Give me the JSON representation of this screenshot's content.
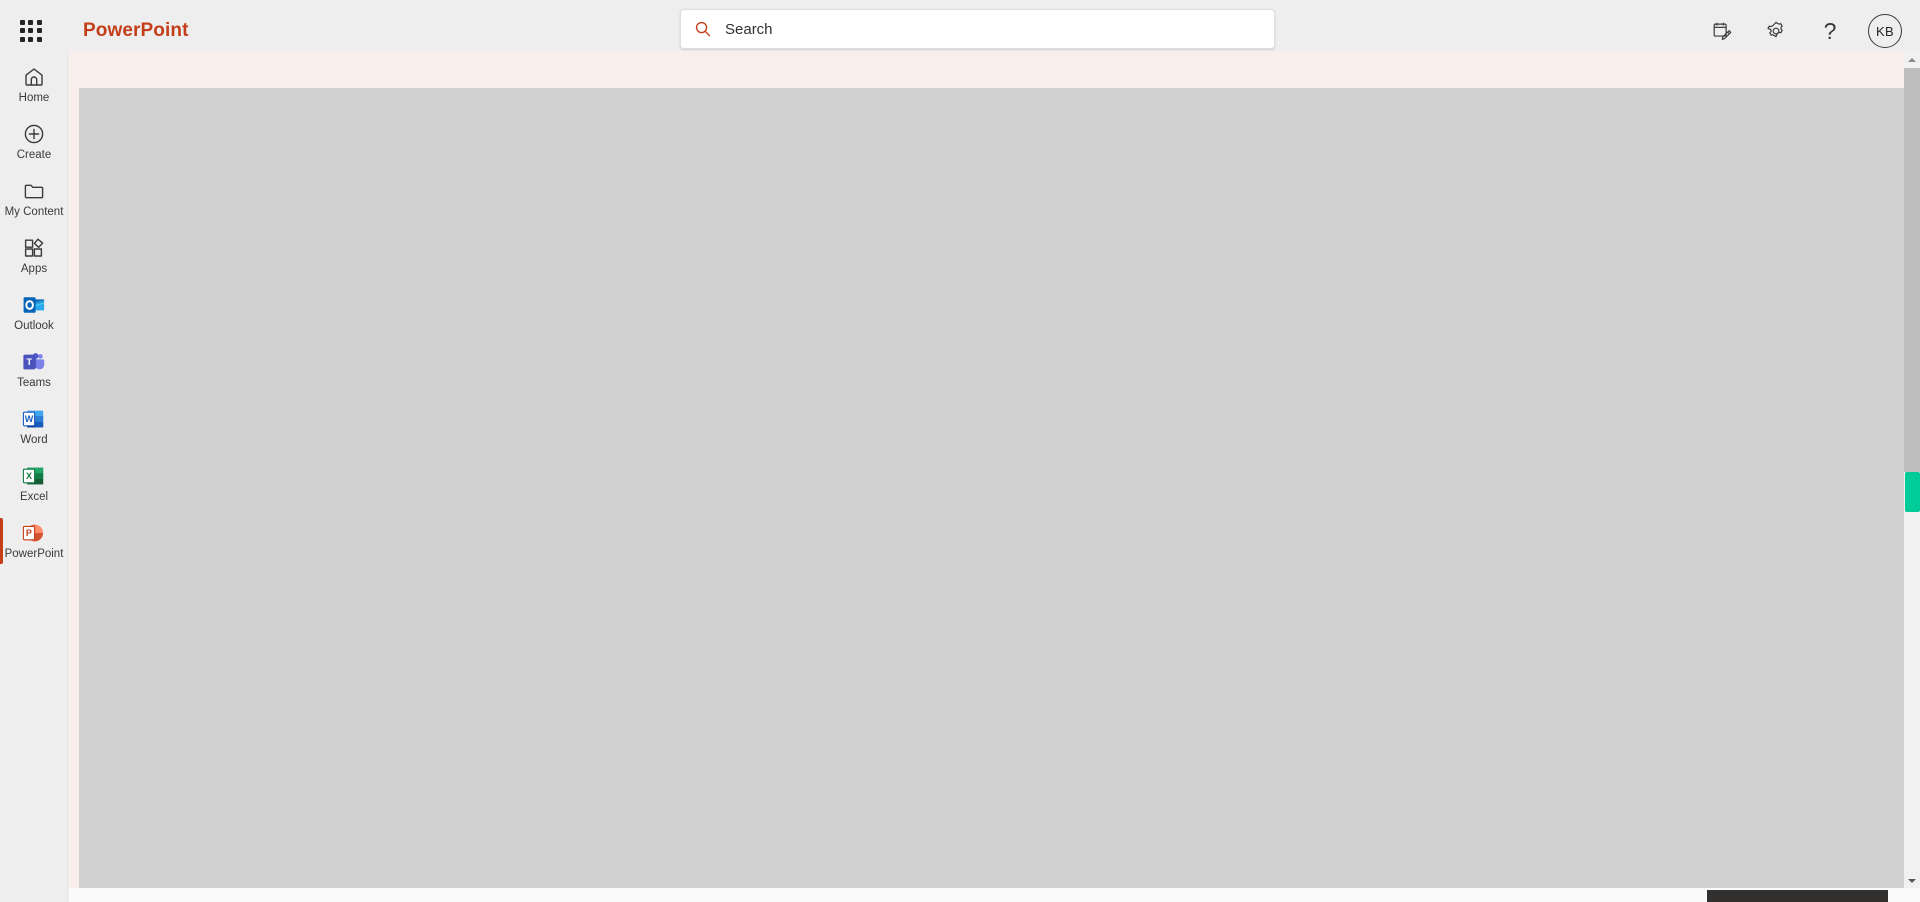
{
  "header": {
    "app_launcher": "app-launcher",
    "brand": "PowerPoint",
    "brand_color": "#c43e1c",
    "search": {
      "placeholder": "Search",
      "value": "",
      "icon": "search-icon"
    },
    "actions": [
      {
        "name": "notes-pencil-icon",
        "label": ""
      },
      {
        "name": "gear-icon",
        "label": ""
      },
      {
        "name": "help-icon",
        "label": "?"
      }
    ],
    "avatar": {
      "initials": "KB"
    }
  },
  "sidebar": {
    "items": [
      {
        "label": "Home",
        "icon": "home-icon",
        "selected": false
      },
      {
        "label": "Create",
        "icon": "create-plus-icon",
        "selected": false
      },
      {
        "label": "My Content",
        "icon": "folder-icon",
        "selected": false
      },
      {
        "label": "Apps",
        "icon": "apps-grid-icon",
        "selected": false
      },
      {
        "label": "Outlook",
        "icon": "outlook-icon",
        "selected": false
      },
      {
        "label": "Teams",
        "icon": "teams-icon",
        "selected": false
      },
      {
        "label": "Word",
        "icon": "word-icon",
        "selected": false
      },
      {
        "label": "Excel",
        "icon": "excel-icon",
        "selected": false
      },
      {
        "label": "PowerPoint",
        "icon": "powerpoint-icon",
        "selected": true
      }
    ],
    "selection_color": "#c43e1c"
  },
  "main": {
    "banner_color": "#f8efec",
    "surface_color": "#d1d1d1",
    "vertical_scrollbar": {
      "thumb_color": "#bdbdbd",
      "accent_thumb_color": "#00cc9a",
      "up_arrow": "chevron-up-icon",
      "down_arrow": "chevron-down-icon"
    },
    "horizontal_scrollbar": {
      "thumb_color": "#323130"
    }
  }
}
